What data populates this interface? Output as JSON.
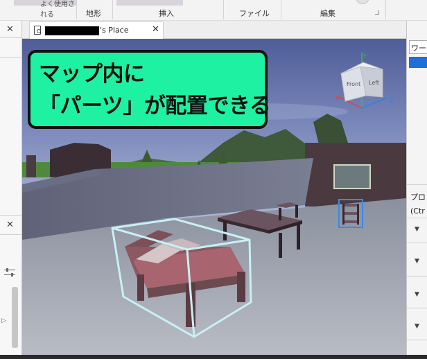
{
  "ribbon": {
    "groups": [
      "地形",
      "挿入",
      "ファイル",
      "編集"
    ],
    "partial_text": "よく使用される"
  },
  "document_tab": {
    "title_suffix": "'s Place",
    "close": "✕"
  },
  "left_dock": {
    "close_top": "✕",
    "close_mid": "✕",
    "arrow": "▷"
  },
  "right_dock": {
    "explorer_label": "ワー",
    "properties_label": "プロ",
    "filter_label": "(Ctr"
  },
  "callout": {
    "line1": "マップ内に",
    "line2": "「パーツ」が配置できる"
  },
  "view_cube": {
    "front": "Front",
    "left": "Left",
    "axis_x": "X",
    "axis_y": "Y",
    "axis_z": "Z"
  },
  "colors": {
    "callout_bg": "#1ef2a2",
    "selection_outline": "#c8f0f4",
    "selection_blue": "#2e8ef0",
    "accent_blue": "#1e6fd9"
  }
}
